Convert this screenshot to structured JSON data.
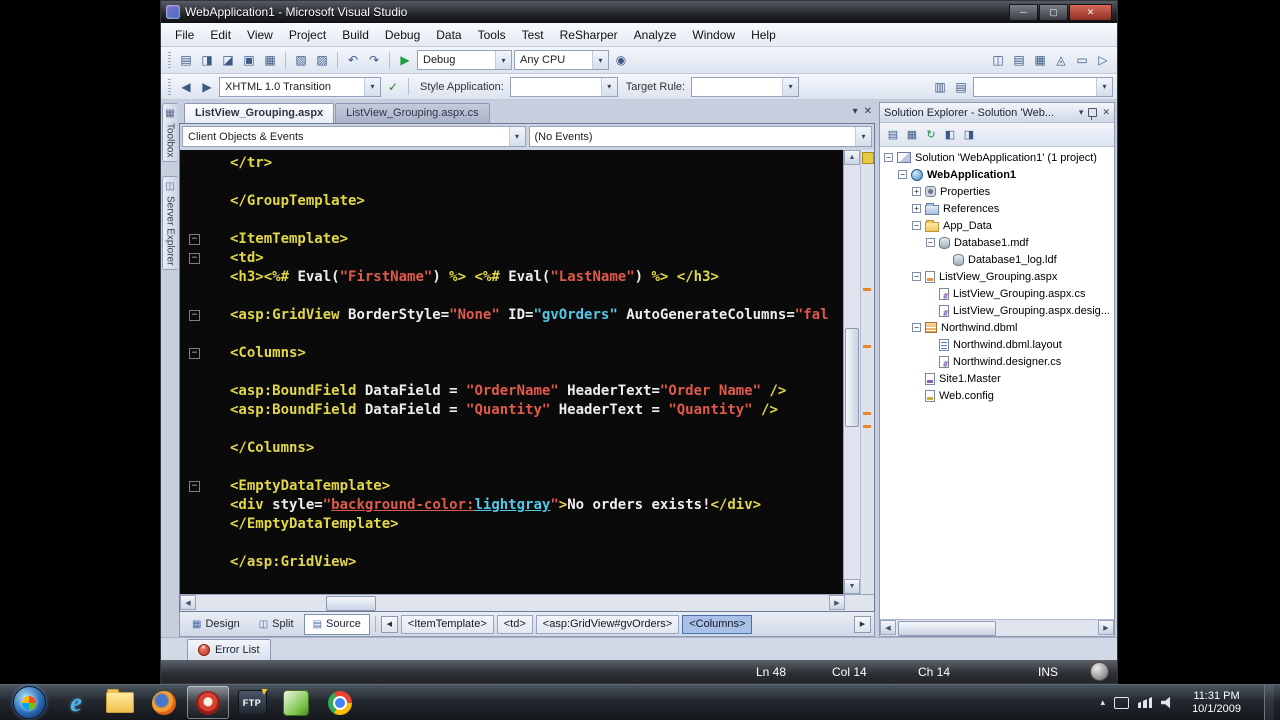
{
  "window": {
    "title": "WebApplication1 - Microsoft Visual Studio"
  },
  "menus": [
    "File",
    "Edit",
    "View",
    "Project",
    "Build",
    "Debug",
    "Data",
    "Tools",
    "Test",
    "ReSharper",
    "Analyze",
    "Window",
    "Help"
  ],
  "toolbars": {
    "row1": {
      "group_a": [
        "new-item-icon",
        "add-item-icon",
        "open-file-icon",
        "save-icon",
        "save-all-icon"
      ],
      "group_b": [
        "comment-icon",
        "uncomment-icon"
      ],
      "group_c": [
        "undo-icon",
        "redo-icon"
      ],
      "group_debug": [
        "start-debug-icon"
      ],
      "debug_value": "Debug",
      "cpu_value": "Any CPU",
      "group_d": [
        "find-icon"
      ],
      "group_right": [
        "solution-explorer-icon",
        "properties-window-icon",
        "toolbox-icon",
        "error-list-icon",
        "output-window-icon",
        "command-window-icon"
      ]
    },
    "row2": {
      "nav": [
        "navigate-back-icon",
        "navigate-forward-icon"
      ],
      "doctype_value": "XHTML 1.0 Transition",
      "after_doctype": [
        "check-html-icon"
      ],
      "style_application_label": "Style Application:",
      "style_application_value": "",
      "target_rule_label": "Target Rule:",
      "target_rule_value": "",
      "group_right": [
        "style-sheet-icon",
        "properties-window-icon"
      ]
    }
  },
  "left_tabs": [
    {
      "label": "Toolbox",
      "icon": "toolbox-tab-icon"
    },
    {
      "label": "Server Explorer",
      "icon": "server-explorer-tab-icon"
    }
  ],
  "editor": {
    "tabs": [
      {
        "label": "ListView_Grouping.aspx",
        "active": true
      },
      {
        "label": "ListView_Grouping.aspx.cs",
        "active": false
      }
    ],
    "object_combo": "Client Objects & Events",
    "event_combo": "(No Events)",
    "views": [
      {
        "label": "Design",
        "icon": "design-view-icon"
      },
      {
        "label": "Split",
        "icon": "split-view-icon"
      },
      {
        "label": "Source",
        "icon": "source-view-icon",
        "active": true
      }
    ],
    "breadcrumbs": [
      {
        "label": "<ItemTemplate>"
      },
      {
        "label": "<td>"
      },
      {
        "label": "<asp:GridView#gvOrders>"
      },
      {
        "label": "<Columns>",
        "active": true
      }
    ]
  },
  "code": {
    "lines": [
      {
        "tokens": [
          {
            "t": "</tr>",
            "c": "y"
          }
        ]
      },
      {
        "tokens": []
      },
      {
        "tokens": [
          {
            "t": "</GroupTemplate>",
            "c": "y"
          }
        ]
      },
      {
        "tokens": []
      },
      {
        "fold": true,
        "tokens": [
          {
            "t": "<ItemTemplate>",
            "c": "y"
          }
        ]
      },
      {
        "fold": true,
        "tokens": [
          {
            "t": "<td>",
            "c": "y"
          }
        ]
      },
      {
        "tokens": [
          {
            "t": "<h3>",
            "c": "y"
          },
          {
            "t": "<%# ",
            "c": "y"
          },
          {
            "t": "Eval(",
            "c": "w"
          },
          {
            "t": "\"FirstName\"",
            "c": "r"
          },
          {
            "t": ") ",
            "c": "w"
          },
          {
            "t": "%> ",
            "c": "y"
          },
          {
            "t": "<%# ",
            "c": "y"
          },
          {
            "t": "Eval(",
            "c": "w"
          },
          {
            "t": "\"LastName\"",
            "c": "r"
          },
          {
            "t": ") ",
            "c": "w"
          },
          {
            "t": "%> ",
            "c": "y"
          },
          {
            "t": "</h3>",
            "c": "y"
          }
        ]
      },
      {
        "tokens": []
      },
      {
        "fold": true,
        "tokens": [
          {
            "t": "<asp:GridView ",
            "c": "y"
          },
          {
            "t": "BorderStyle=",
            "c": "w"
          },
          {
            "t": "\"None\"",
            "c": "r"
          },
          {
            "t": " ID=",
            "c": "w"
          },
          {
            "t": "\"gvOrders\"",
            "c": "t"
          },
          {
            "t": " AutoGenerateColumns=",
            "c": "w"
          },
          {
            "t": "\"fal",
            "c": "r"
          }
        ]
      },
      {
        "tokens": []
      },
      {
        "fold": true,
        "tokens": [
          {
            "t": "<Columns>",
            "c": "y"
          }
        ]
      },
      {
        "tokens": []
      },
      {
        "tokens": [
          {
            "t": "<asp:BoundField ",
            "c": "y"
          },
          {
            "t": "DataField = ",
            "c": "w"
          },
          {
            "t": "\"OrderName\"",
            "c": "r"
          },
          {
            "t": " HeaderText=",
            "c": "w"
          },
          {
            "t": "\"Order Name\"",
            "c": "r"
          },
          {
            "t": " />",
            "c": "y"
          }
        ]
      },
      {
        "tokens": [
          {
            "t": "<asp:BoundField ",
            "c": "y"
          },
          {
            "t": "DataField = ",
            "c": "w"
          },
          {
            "t": "\"Quantity\"",
            "c": "r"
          },
          {
            "t": " HeaderText = ",
            "c": "w"
          },
          {
            "t": "\"Quantity\"",
            "c": "r"
          },
          {
            "t": " />",
            "c": "y"
          }
        ]
      },
      {
        "tokens": []
      },
      {
        "tokens": [
          {
            "t": "</Columns>",
            "c": "y"
          }
        ]
      },
      {
        "tokens": []
      },
      {
        "fold": true,
        "tokens": [
          {
            "t": "<EmptyDataTemplate>",
            "c": "y"
          }
        ]
      },
      {
        "tokens": [
          {
            "t": "<div ",
            "c": "y"
          },
          {
            "t": "style=",
            "c": "w"
          },
          {
            "t": "\"",
            "c": "r"
          },
          {
            "t": "background-color:",
            "c": "ru"
          },
          {
            "t": "lightgray",
            "c": "u"
          },
          {
            "t": "\"",
            "c": "r"
          },
          {
            "t": ">",
            "c": "y"
          },
          {
            "t": "No orders exists!",
            "c": "w"
          },
          {
            "t": "</div>",
            "c": "y"
          }
        ]
      },
      {
        "tokens": [
          {
            "t": "</EmptyDataTemplate>",
            "c": "y"
          }
        ]
      },
      {
        "tokens": []
      },
      {
        "tokens": [
          {
            "t": "</asp:GridView>",
            "c": "y"
          }
        ]
      }
    ]
  },
  "solution_explorer": {
    "title": "Solution Explorer - Solution 'Web...",
    "toolbar_icons": [
      "properties-window-icon",
      "show-all-files-icon",
      "refresh-icon",
      "view-code-icon",
      "view-designer-icon"
    ],
    "items": [
      {
        "label": "Solution 'WebApplication1' (1 project)",
        "indent": 0,
        "icon": "solution",
        "expander": "minus"
      },
      {
        "label": "WebApplication1",
        "indent": 1,
        "icon": "project",
        "expander": "minus",
        "bold": true
      },
      {
        "label": "Properties",
        "indent": 2,
        "icon": "properties",
        "expander": "plus"
      },
      {
        "label": "References",
        "indent": 2,
        "icon": "references",
        "expander": "plus"
      },
      {
        "label": "App_Data",
        "indent": 2,
        "icon": "folder",
        "expander": "minus"
      },
      {
        "label": "Database1.mdf",
        "indent": 3,
        "icon": "database",
        "expander": "minus"
      },
      {
        "label": "Database1_log.ldf",
        "indent": 4,
        "icon": "database"
      },
      {
        "label": "ListView_Grouping.aspx",
        "indent": 2,
        "icon": "aspx",
        "expander": "minus"
      },
      {
        "label": "ListView_Grouping.aspx.cs",
        "indent": 3,
        "icon": "cs"
      },
      {
        "label": "ListView_Grouping.aspx.desig...",
        "indent": 3,
        "icon": "cs"
      },
      {
        "label": "Northwind.dbml",
        "indent": 2,
        "icon": "dbml",
        "expander": "minus"
      },
      {
        "label": "Northwind.dbml.layout",
        "indent": 3,
        "icon": "layout"
      },
      {
        "label": "Northwind.designer.cs",
        "indent": 3,
        "icon": "cs"
      },
      {
        "label": "Site1.Master",
        "indent": 2,
        "icon": "master"
      },
      {
        "label": "Web.config",
        "indent": 2,
        "icon": "config"
      }
    ]
  },
  "error_list": {
    "label": "Error List"
  },
  "status_bar": {
    "ln": "Ln 48",
    "col": "Col 14",
    "ch": "Ch 14",
    "mode": "INS"
  },
  "taskbar": {
    "items": [
      {
        "name": "start-button",
        "type": "start"
      },
      {
        "name": "internet-explorer-icon",
        "type": "ie"
      },
      {
        "name": "explorer-folder-icon",
        "type": "folder"
      },
      {
        "name": "firefox-icon",
        "type": "firefox"
      },
      {
        "name": "screen-recorder-icon",
        "type": "recorder",
        "active": true
      },
      {
        "name": "ftp-client-icon",
        "type": "ftp",
        "label": "FTP"
      },
      {
        "name": "green-app-icon",
        "type": "green"
      },
      {
        "name": "chrome-icon",
        "type": "chrome"
      }
    ],
    "tray_icons": [
      "hidden-icons-chevron",
      "display-icon",
      "network-icon",
      "volume-icon"
    ],
    "clock_time": "11:31 PM",
    "clock_date": "10/1/2009"
  },
  "colors": {
    "tag": "#e2d748",
    "string": "#e05a4c",
    "value": "#55c8e8",
    "text": "#eeeeee",
    "editor_bg": "#0a0a0a"
  }
}
